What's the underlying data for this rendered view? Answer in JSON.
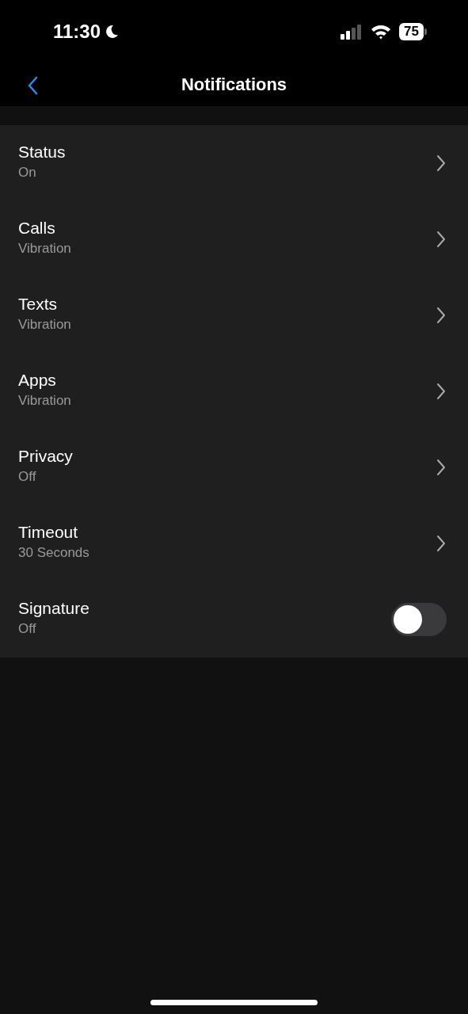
{
  "status_bar": {
    "time": "11:30",
    "battery": "75"
  },
  "nav": {
    "title": "Notifications"
  },
  "settings": [
    {
      "kind": "link",
      "title": "Status",
      "value": "On"
    },
    {
      "kind": "link",
      "title": "Calls",
      "value": "Vibration"
    },
    {
      "kind": "link",
      "title": "Texts",
      "value": "Vibration"
    },
    {
      "kind": "link",
      "title": "Apps",
      "value": "Vibration"
    },
    {
      "kind": "link",
      "title": "Privacy",
      "value": "Off"
    },
    {
      "kind": "link",
      "title": "Timeout",
      "value": "30 Seconds"
    },
    {
      "kind": "toggle",
      "title": "Signature",
      "value": "Off",
      "on": false
    }
  ]
}
